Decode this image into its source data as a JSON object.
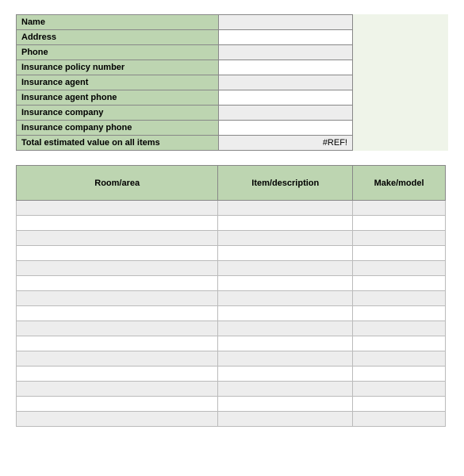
{
  "info": {
    "rows": [
      {
        "label": "Name",
        "value": ""
      },
      {
        "label": "Address",
        "value": ""
      },
      {
        "label": "Phone",
        "value": ""
      },
      {
        "label": "Insurance policy number",
        "value": ""
      },
      {
        "label": "Insurance agent",
        "value": ""
      },
      {
        "label": "Insurance agent phone",
        "value": ""
      },
      {
        "label": "Insurance company",
        "value": ""
      },
      {
        "label": "Insurance company phone",
        "value": ""
      }
    ],
    "total_label": "Total estimated value on all items",
    "total_value": "#REF!"
  },
  "items": {
    "headers": {
      "room": "Room/area",
      "item": "Item/description",
      "make": "Make/model"
    },
    "row_count": 15
  }
}
